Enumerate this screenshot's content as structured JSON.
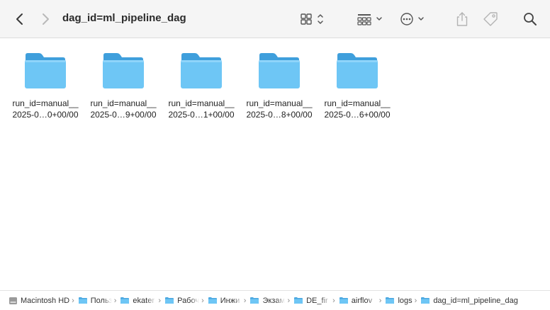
{
  "toolbar": {
    "title": "dag_id=ml_pipeline_dag",
    "icons": {
      "back": "chevron-left-icon",
      "forward": "chevron-right-icon",
      "view": "grid-view-icon",
      "group": "group-icon",
      "more": "ellipsis-icon",
      "share": "share-icon",
      "tag": "tag-icon",
      "search": "search-icon"
    }
  },
  "items": [
    {
      "line1": "run_id=manual__",
      "line2": "2025-0…0+00/00"
    },
    {
      "line1": "run_id=manual__",
      "line2": "2025-0…9+00/00"
    },
    {
      "line1": "run_id=manual__",
      "line2": "2025-0…1+00/00"
    },
    {
      "line1": "run_id=manual__",
      "line2": "2025-0…8+00/00"
    },
    {
      "line1": "run_id=manual__",
      "line2": "2025-0…6+00/00"
    }
  ],
  "pathbar": [
    {
      "label": "Macintosh HD",
      "icon": "disk-icon"
    },
    {
      "label": "Польз",
      "icon": "folder-icon"
    },
    {
      "label": "ekater",
      "icon": "folder-icon"
    },
    {
      "label": "Рабоч",
      "icon": "folder-icon"
    },
    {
      "label": "Инжи",
      "icon": "folder-icon"
    },
    {
      "label": "Экзам",
      "icon": "folder-icon"
    },
    {
      "label": "DE_fir",
      "icon": "folder-icon"
    },
    {
      "label": "airflov",
      "icon": "folder-icon"
    },
    {
      "label": "logs",
      "icon": "folder-icon"
    },
    {
      "label": "dag_id=ml_pipeline_dag",
      "icon": "folder-icon"
    }
  ],
  "colors": {
    "folder_body": "#6ec6f5",
    "folder_tab": "#4aa7e0",
    "toolbar_bg": "#f5f5f5",
    "icon_gray": "#5a5a5a"
  }
}
